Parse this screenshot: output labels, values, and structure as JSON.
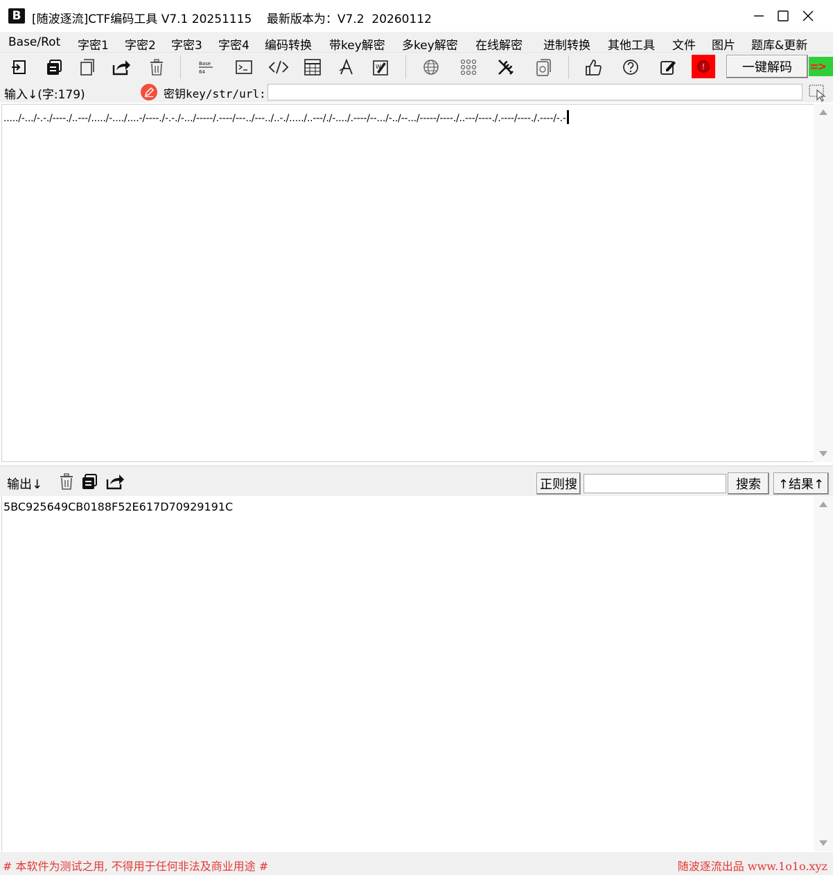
{
  "window": {
    "logo_text": "B",
    "title": "[随波逐流]CTF编码工具 V7.1 20251115    最新版本为：V7.2  20260112",
    "controls": [
      "minimize",
      "maximize",
      "close"
    ]
  },
  "menu": {
    "items": [
      "Base/Rot",
      "字密1",
      "字密2",
      "字密3",
      "字密4",
      "编码转换",
      "带key解密",
      "多key解密",
      "在线解密",
      "进制转换",
      "其他工具",
      "文件",
      "图片",
      "题库&更新"
    ]
  },
  "toolbar": {
    "icons": [
      "import-icon",
      "copy-all-icon",
      "paste-icon",
      "share-icon",
      "trash-icon",
      "base-convert-icon",
      "terminal-icon",
      "code-icon",
      "table-icon",
      "font-icon",
      "edit-image-icon",
      "globe-icon",
      "grid-icon",
      "tools-icon",
      "document-icon",
      "thumbs-up-icon",
      "help-icon",
      "edit-icon",
      "record-icon"
    ],
    "decode_label": "一键解码",
    "arrow_label": "=>",
    "accent_red": "#ff0000",
    "accent_green": "#2fcf3a"
  },
  "input": {
    "label": "输入↓(字:179)",
    "key_label": "密钥key/str/url:",
    "key_value": "",
    "text": "...../-.../-.-./----./..---/...../-..../....-/----./-.-./-.../-----/.----/---../---../..-./...../..---/./-..../.----/--.../-../--.../-----/----./..---/----./.----/----./.----/-.-"
  },
  "output": {
    "label": "输出↓",
    "regex_label": "正则搜",
    "search_value": "",
    "search_label": "搜索",
    "result_label": "↑结果↑",
    "text": "5BC925649CB0188F52E617D70929191C"
  },
  "footer": {
    "left": "# 本软件为测试之用, 不得用于任何非法及商业用途 #",
    "right": "随波逐流出品 www.1o1o.xyz",
    "color": "#e53935"
  }
}
